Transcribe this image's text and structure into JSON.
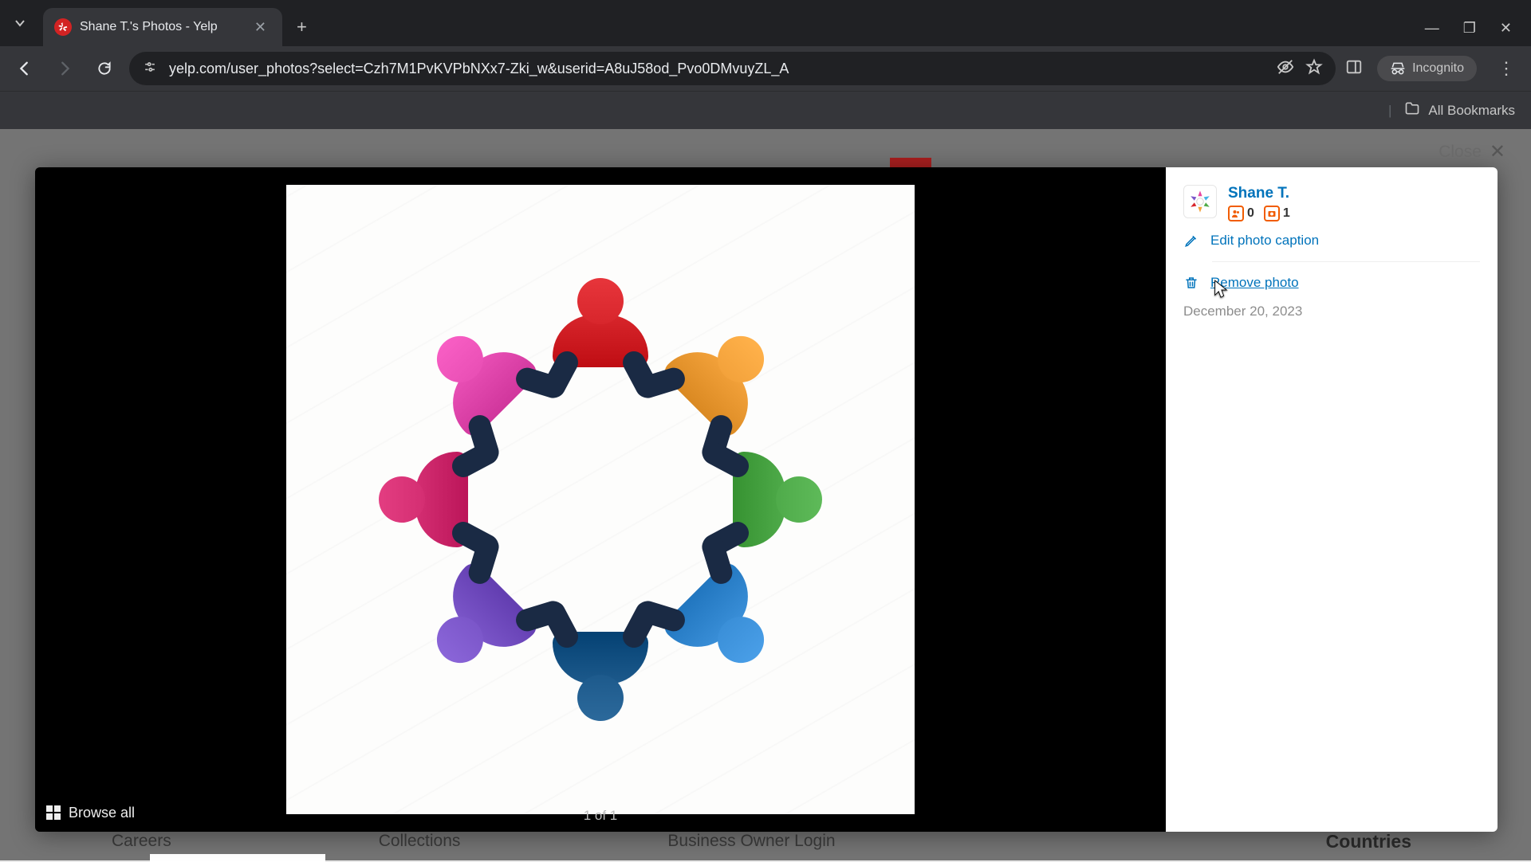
{
  "browser": {
    "tab_title": "Shane T.'s Photos - Yelp",
    "url": "yelp.com/user_photos?select=Czh7M1PvKVPbNXx7-Zki_w&userid=A8uJ58od_Pvo0DMvuyZL_A",
    "incognito_label": "Incognito",
    "all_bookmarks": "All Bookmarks"
  },
  "lightbox": {
    "close_label": "Close",
    "browse_all": "Browse all",
    "counter": "1 of 1"
  },
  "panel": {
    "user_name": "Shane T.",
    "friends_count": "0",
    "photos_count": "1",
    "edit_caption": "Edit photo caption",
    "remove_photo": "Remove photo",
    "date": "December 20, 2023"
  },
  "footer": {
    "careers": "Careers",
    "collections": "Collections",
    "biz_login": "Business Owner Login",
    "countries": "Countries"
  },
  "people_colors": [
    {
      "angle": 0,
      "fill": "#d8262c"
    },
    {
      "angle": 45,
      "fill": "#f3a23b"
    },
    {
      "angle": 90,
      "fill": "#4fab4a"
    },
    {
      "angle": 135,
      "fill": "#3a8fd8"
    },
    {
      "angle": 180,
      "fill": "#1d5a8c"
    },
    {
      "angle": 225,
      "fill": "#7b56c9"
    },
    {
      "angle": 270,
      "fill": "#d42e72"
    },
    {
      "angle": 315,
      "fill": "#e94fb5"
    }
  ]
}
